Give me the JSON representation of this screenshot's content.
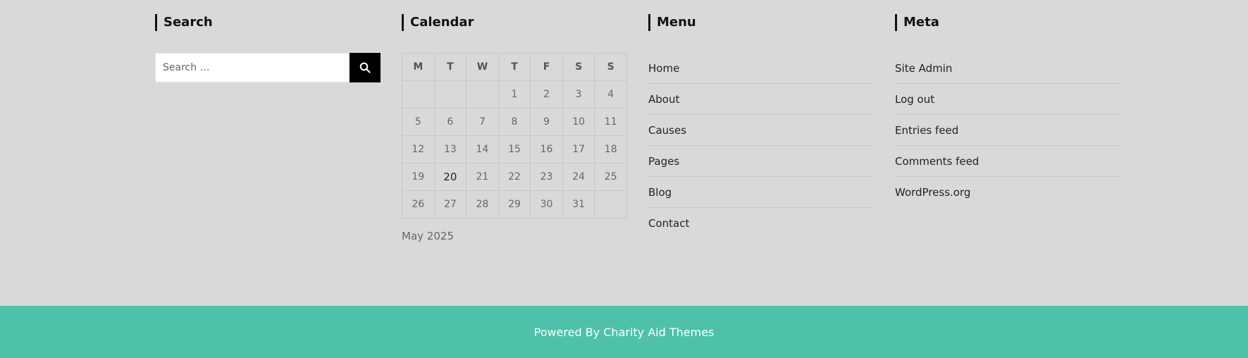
{
  "search": {
    "title": "Search",
    "placeholder": "Search …",
    "button_icon": "search-icon"
  },
  "calendar": {
    "title": "Calendar",
    "weekdays": [
      "M",
      "T",
      "W",
      "T",
      "F",
      "S",
      "S"
    ],
    "weeks": [
      [
        "",
        "",
        "",
        "1",
        "2",
        "3",
        "4"
      ],
      [
        "5",
        "6",
        "7",
        "8",
        "9",
        "10",
        "11"
      ],
      [
        "12",
        "13",
        "14",
        "15",
        "16",
        "17",
        "18"
      ],
      [
        "19",
        "20",
        "21",
        "22",
        "23",
        "24",
        "25"
      ],
      [
        "26",
        "27",
        "28",
        "29",
        "30",
        "31",
        ""
      ]
    ],
    "today": "20",
    "caption": "May 2025"
  },
  "menu": {
    "title": "Menu",
    "items": [
      "Home",
      "About",
      "Causes",
      "Pages",
      "Blog",
      "Contact"
    ]
  },
  "meta": {
    "title": "Meta",
    "items": [
      "Site Admin",
      "Log out",
      "Entries feed",
      "Comments feed",
      "WordPress.org"
    ]
  },
  "footer": {
    "text": "Powered By Charity Aid Themes"
  },
  "colors": {
    "background": "#d9d9d9",
    "footer": "#4dc2a8",
    "search_button": "#000000"
  }
}
